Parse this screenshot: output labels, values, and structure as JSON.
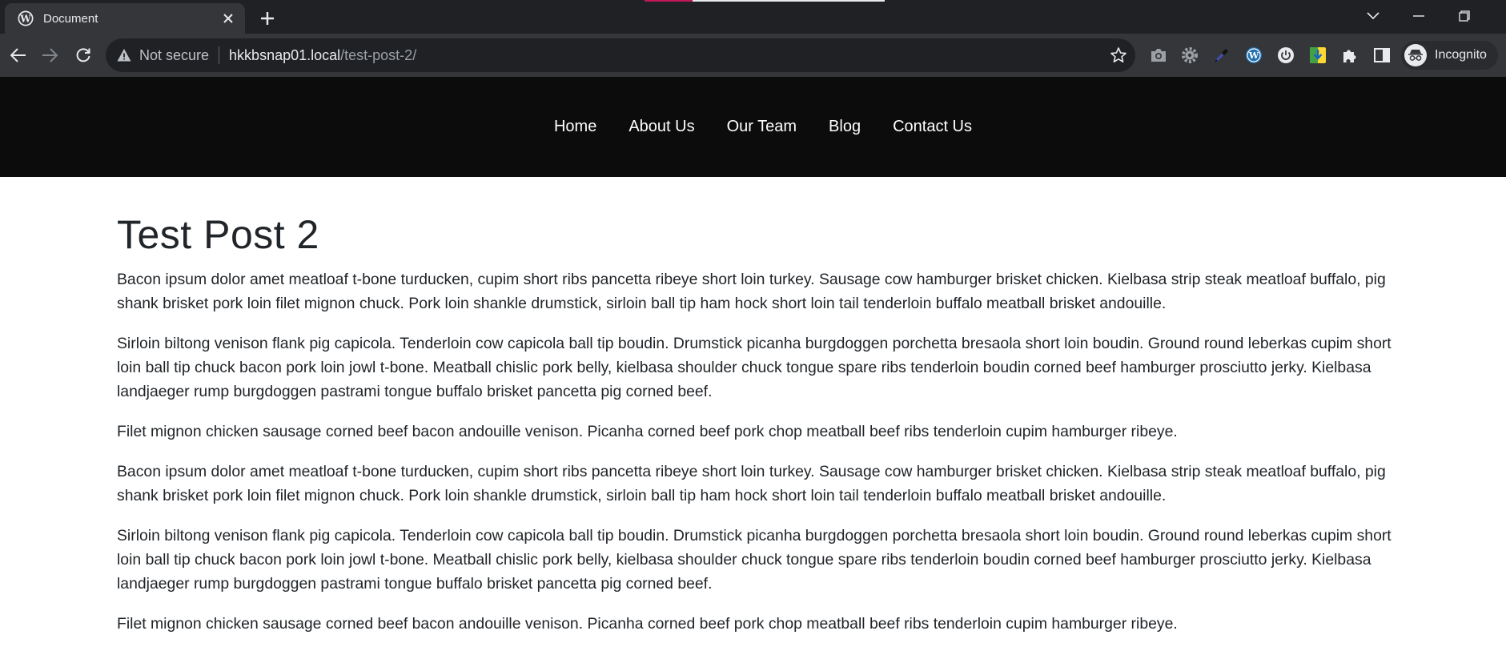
{
  "browser": {
    "tab_title": "Document",
    "omnibox": {
      "security_text": "Not secure",
      "url_host": "hkkbsnap01.local",
      "url_path": "/test-post-2/"
    },
    "profile_label": "Incognito"
  },
  "site": {
    "nav": [
      {
        "label": "Home"
      },
      {
        "label": "About Us"
      },
      {
        "label": "Our Team"
      },
      {
        "label": "Blog"
      },
      {
        "label": "Contact Us"
      }
    ]
  },
  "post": {
    "title": "Test Post 2",
    "paragraphs": [
      "Bacon ipsum dolor amet meatloaf t-bone turducken, cupim short ribs pancetta ribeye short loin turkey. Sausage cow hamburger brisket chicken. Kielbasa strip steak meatloaf buffalo, pig shank brisket pork loin filet mignon chuck. Pork loin shankle drumstick, sirloin ball tip ham hock short loin tail tenderloin buffalo meatball brisket andouille.",
      "Sirloin biltong venison flank pig capicola. Tenderloin cow capicola ball tip boudin. Drumstick picanha burgdoggen porchetta bresaola short loin boudin. Ground round leberkas cupim short loin ball tip chuck bacon pork loin jowl t-bone. Meatball chislic pork belly, kielbasa shoulder chuck tongue spare ribs tenderloin boudin corned beef hamburger prosciutto jerky. Kielbasa landjaeger rump burgdoggen pastrami tongue buffalo brisket pancetta pig corned beef.",
      "Filet mignon chicken sausage corned beef bacon andouille venison. Picanha corned beef pork chop meatball beef ribs tenderloin cupim hamburger ribeye.",
      "Bacon ipsum dolor amet meatloaf t-bone turducken, cupim short ribs pancetta ribeye short loin turkey. Sausage cow hamburger brisket chicken. Kielbasa strip steak meatloaf buffalo, pig shank brisket pork loin filet mignon chuck. Pork loin shankle drumstick, sirloin ball tip ham hock short loin tail tenderloin buffalo meatball brisket andouille.",
      "Sirloin biltong venison flank pig capicola. Tenderloin cow capicola ball tip boudin. Drumstick picanha burgdoggen porchetta bresaola short loin boudin. Ground round leberkas cupim short loin ball tip chuck bacon pork loin jowl t-bone. Meatball chislic pork belly, kielbasa shoulder chuck tongue spare ribs tenderloin boudin corned beef hamburger prosciutto jerky. Kielbasa landjaeger rump burgdoggen pastrami tongue buffalo brisket pancetta pig corned beef.",
      "Filet mignon chicken sausage corned beef bacon andouille venison. Picanha corned beef pork chop meatball beef ribs tenderloin cupim hamburger ribeye."
    ]
  },
  "colors": {
    "chrome_dark": "#202124",
    "chrome_toolbar": "#35363a",
    "site_header": "#0c0c0c",
    "body_text": "#212529"
  },
  "icons": [
    "wordpress-icon",
    "close-icon",
    "plus-icon",
    "chevron-down-icon",
    "minimize-icon",
    "restore-icon",
    "close-window-icon",
    "back-arrow-icon",
    "forward-arrow-icon",
    "reload-icon",
    "warning-icon",
    "star-icon",
    "camera-icon",
    "gear-icon",
    "eyedropper-icon",
    "wordpress-icon",
    "power-icon",
    "download-icon",
    "puzzle-icon",
    "side-panel-icon",
    "incognito-icon"
  ]
}
